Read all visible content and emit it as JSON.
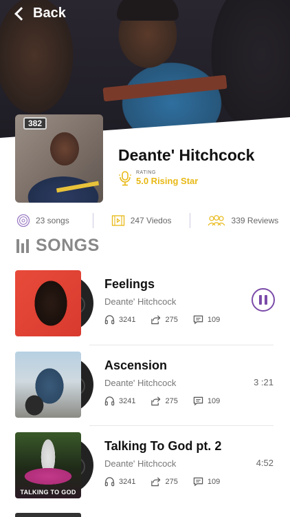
{
  "header": {
    "back_label": "Back"
  },
  "artist": {
    "name": "Deante' Hitchcock",
    "plate_text": "382",
    "rating_label": "RATING",
    "rating_value": "5.0 Rising Star",
    "accent_color": "#e8b814"
  },
  "stats": [
    {
      "icon": "vinyl-icon",
      "label": "23 songs"
    },
    {
      "icon": "film-icon",
      "label": "247 Viedos"
    },
    {
      "icon": "people-icon",
      "label": "339 Reviews"
    }
  ],
  "section": {
    "title": "SONGS"
  },
  "songs": [
    {
      "title": "Feelings",
      "artist": "Deante' Hitchcock",
      "plays": "3241",
      "shares": "275",
      "comments": "109",
      "duration": "",
      "playing": true
    },
    {
      "title": "Ascension",
      "artist": "Deante' Hitchcock",
      "plays": "3241",
      "shares": "275",
      "comments": "109",
      "duration": "3 :21",
      "playing": false
    },
    {
      "title": "Talking To God pt. 2",
      "artist": "Deante' Hitchcock",
      "plays": "3241",
      "shares": "275",
      "comments": "109",
      "duration": "4:52",
      "playing": false,
      "cover_text": "TALKING TO GOD"
    }
  ],
  "colors": {
    "purple": "#7a4aa8",
    "gold": "#e8b814"
  }
}
